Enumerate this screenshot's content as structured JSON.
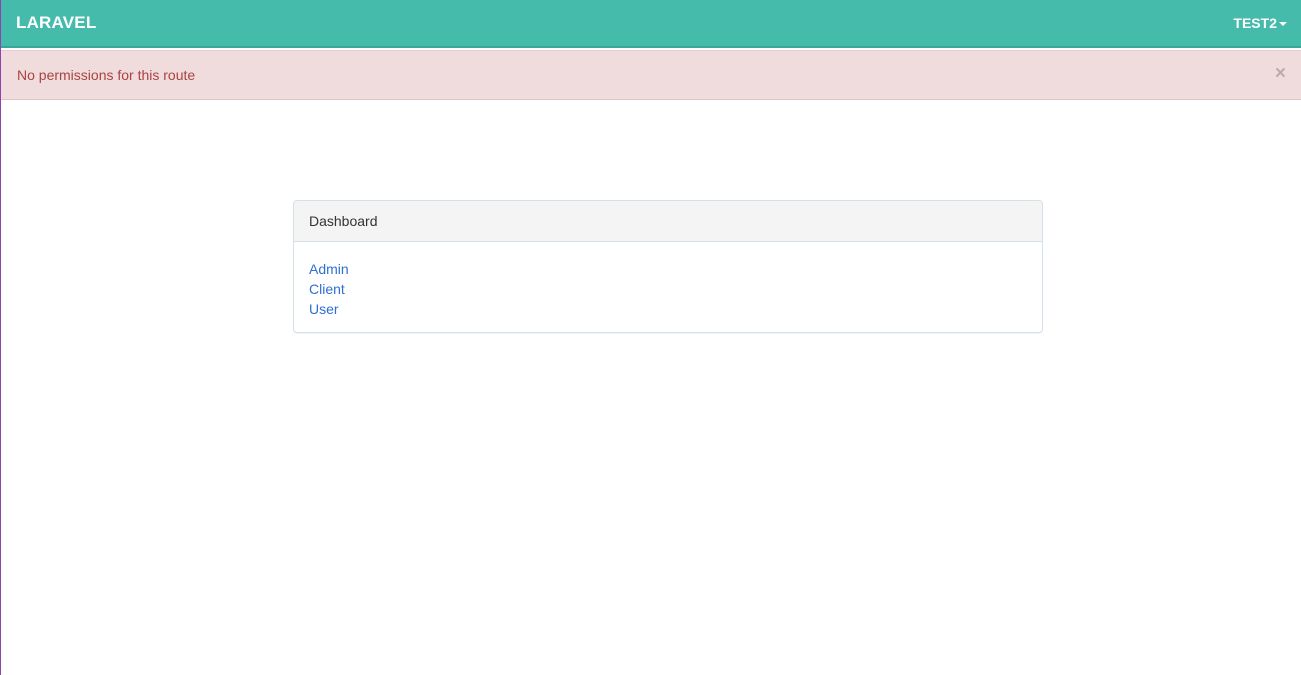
{
  "navbar": {
    "brand": "LARAVEL",
    "user_menu_label": "TEST2"
  },
  "alert": {
    "message": "No permissions for this route",
    "close_label": "×"
  },
  "panel": {
    "heading": "Dashboard",
    "links": [
      {
        "label": "Admin"
      },
      {
        "label": "Client"
      },
      {
        "label": "User"
      }
    ]
  },
  "colors": {
    "navbar_bg": "#44bbab",
    "alert_bg": "#f0dcdc",
    "alert_text": "#a94442",
    "link": "#2f6fd0"
  }
}
